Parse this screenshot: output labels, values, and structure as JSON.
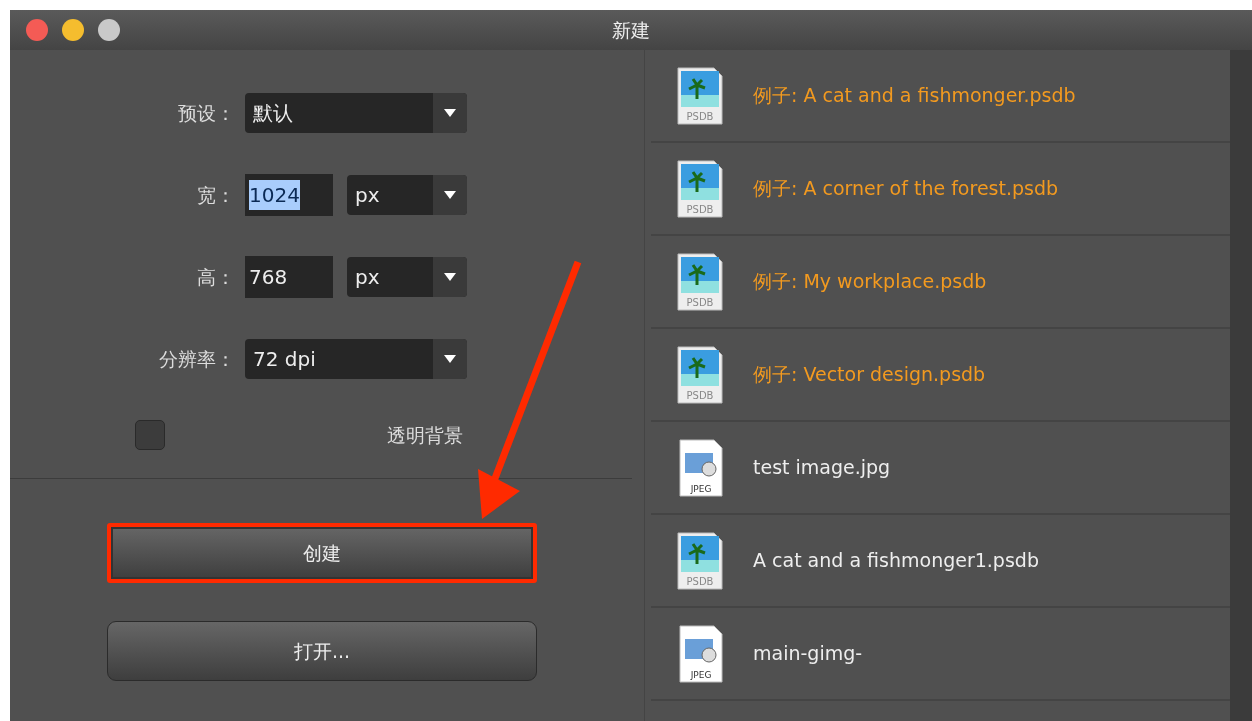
{
  "window": {
    "title": "新建"
  },
  "form": {
    "preset": {
      "label": "预设：",
      "value": "默认"
    },
    "width": {
      "label": "宽：",
      "value": "1024",
      "text_selected": true,
      "unit": "px"
    },
    "height": {
      "label": "高：",
      "value": "768",
      "text_selected": false,
      "unit": "px"
    },
    "resolution": {
      "label": "分辨率：",
      "value": "72 dpi"
    },
    "transparent": {
      "label": "透明背景",
      "checked": false
    }
  },
  "buttons": [
    {
      "label": "创建",
      "highlighted": true
    },
    {
      "label": "打开...",
      "highlighted": false
    }
  ],
  "files": [
    {
      "name": "例子: A cat and a fishmonger.psdb",
      "kind": "psdb",
      "icon_label": "PSDB",
      "example": true
    },
    {
      "name": "例子: A corner of the forest.psdb",
      "kind": "psdb",
      "icon_label": "PSDB",
      "example": true
    },
    {
      "name": "例子: My workplace.psdb",
      "kind": "psdb",
      "icon_label": "PSDB",
      "example": true
    },
    {
      "name": "例子: Vector design.psdb",
      "kind": "psdb",
      "icon_label": "PSDB",
      "example": true
    },
    {
      "name": "test image.jpg",
      "kind": "jpeg",
      "icon_label": "JPEG",
      "example": false
    },
    {
      "name": "A cat and a fishmonger1.psdb",
      "kind": "psdb",
      "icon_label": "PSDB",
      "example": false
    },
    {
      "name": "main-gimg-",
      "kind": "jpeg",
      "icon_label": "JPEG",
      "example": false
    }
  ]
}
